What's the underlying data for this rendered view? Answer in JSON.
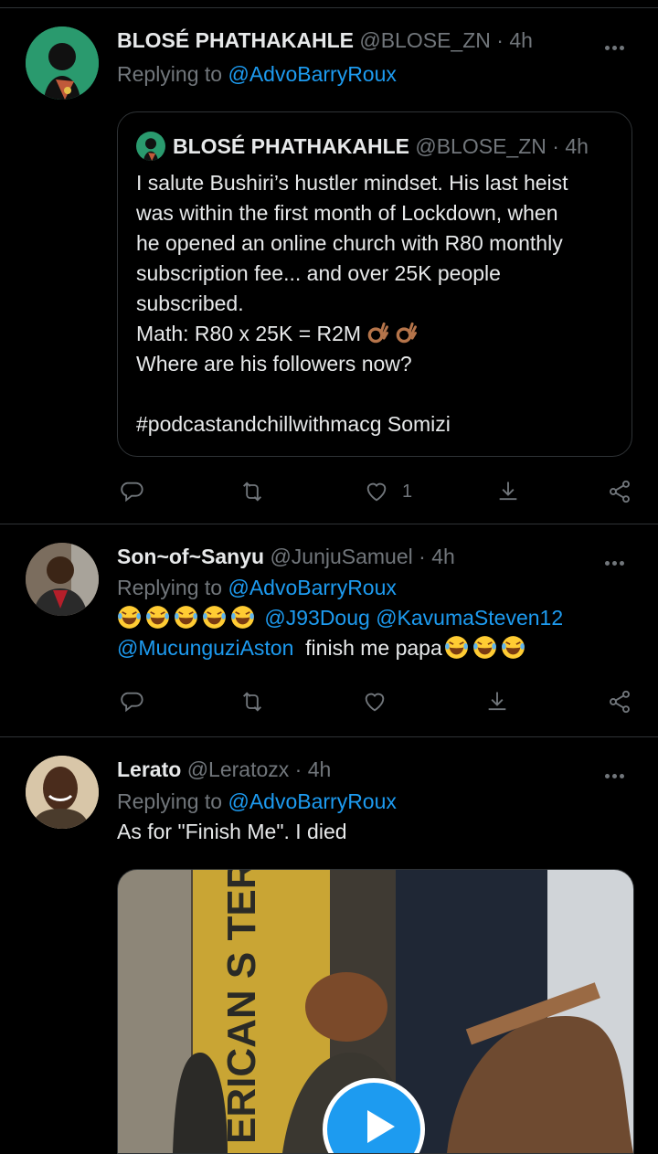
{
  "tweets": [
    {
      "name": "BLOSÉ PHATHAKAHLE",
      "handle": "@BLOSE_ZN",
      "sep": "·",
      "time": "4h",
      "replying_prefix": "Replying to ",
      "replying_to": "@AdvoBarryRoux",
      "quote": {
        "name": "BLOSÉ PHATHAKAHLE",
        "handle": "@BLOSE_ZN",
        "sep": "·",
        "time": "4h",
        "lines": [
          "I salute Bushiri’s hustler mindset. His last heist",
          "was within the first month of Lockdown, when",
          "he opened an online church with R80 monthly",
          "subscription fee... and over 25K people",
          "subscribed.",
          "Math: R80 x 25K = R2M",
          "Where are his followers now?",
          "",
          "#podcastandchillwithmacg Somizi"
        ]
      },
      "like_count": "1"
    },
    {
      "name": "Son~of~Sanyu",
      "handle": "@JunjuSamuel",
      "sep": "·",
      "time": "4h",
      "replying_prefix": "Replying to ",
      "replying_to": "@AdvoBarryRoux",
      "mention_1": "@J93Doug",
      "mention_2": "@KavumaSteven12",
      "mention_3": "@MucunguziAston",
      "text_tail": "finish me papa"
    },
    {
      "name": "Lerato",
      "handle": "@Leratozx",
      "sep": "·",
      "time": "4h",
      "replying_prefix": "Replying to ",
      "replying_to": "@AdvoBarryRoux",
      "text": "As for \"Finish Me\". I died",
      "media_text": "ERICAN S TERNATI"
    }
  ],
  "icons": {
    "reply": "reply-icon",
    "retweet": "retweet-icon",
    "like": "heart-icon",
    "bookmark": "bookmark-icon",
    "share": "share-icon",
    "more": "more-icon",
    "play": "play-icon",
    "emoji_laugh": "rolling-laughing-emoji",
    "emoji_ok": "ok-hand-emoji"
  },
  "colors": {
    "background": "#000000",
    "text": "#e7e9ea",
    "secondary": "#71767b",
    "accent": "#1d9bf0",
    "border": "#2f3336"
  }
}
